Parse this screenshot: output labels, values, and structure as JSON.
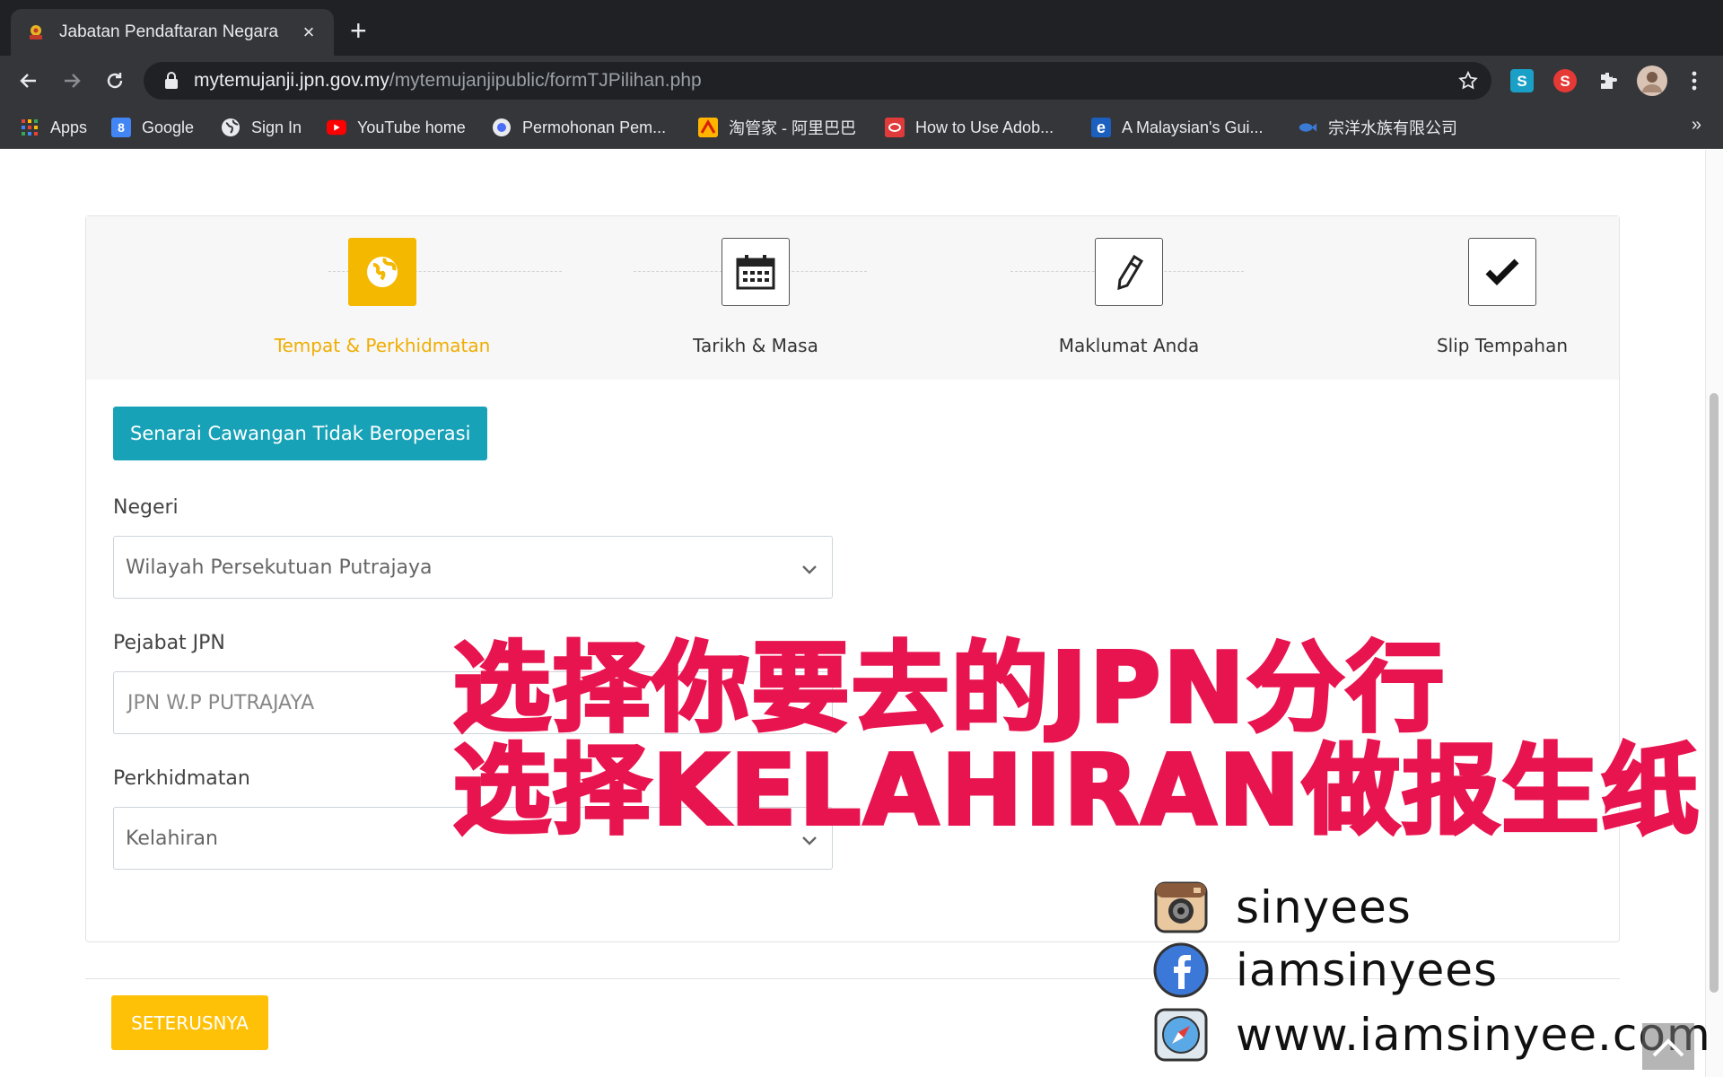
{
  "browser": {
    "tab_title": "Jabatan Pendaftaran Negara",
    "url_host": "mytemujanji.jpn.gov.my",
    "url_path": "/mytemujanjipublic/formTJPilihan.php",
    "bookmarks": [
      {
        "label": "Apps",
        "icon": "apps-grid-icon",
        "color": "#ea4335"
      },
      {
        "label": "Google",
        "icon": "google-sites-icon",
        "color": "#4285f4"
      },
      {
        "label": "Sign In",
        "icon": "globe-icon",
        "color": "#e8eaed"
      },
      {
        "label": "YouTube home",
        "icon": "youtube-icon",
        "color": "#ff0000"
      },
      {
        "label": "Permohonan Pem...",
        "icon": "circle-icon",
        "color": "#4a6cf7"
      },
      {
        "label": "淘管家 - 阿里巴巴",
        "icon": "taoguanjia-icon",
        "color": "#ffb400"
      },
      {
        "label": "How to Use Adob...",
        "icon": "adobe-icon",
        "color": "#e03a3a"
      },
      {
        "label": "A Malaysian's Gui...",
        "icon": "e-icon",
        "color": "#1b5fbf"
      },
      {
        "label": "宗洋水族有限公司",
        "icon": "fish-icon",
        "color": "#3a7bd5"
      }
    ],
    "more_bookmarks": "»"
  },
  "stepper": {
    "steps": [
      {
        "label": "Tempat & Perkhidmatan",
        "icon": "globe-icon",
        "active": true
      },
      {
        "label": "Tarikh & Masa",
        "icon": "calendar-icon",
        "active": false
      },
      {
        "label": "Maklumat Anda",
        "icon": "pencil-icon",
        "active": false
      },
      {
        "label": "Slip Tempahan",
        "icon": "checkmark-icon",
        "active": false
      }
    ],
    "active_color": "#f5b800"
  },
  "form": {
    "branch_button": "Senarai Cawangan Tidak Beroperasi",
    "negeri_label": "Negeri",
    "negeri_value": "Wilayah Persekutuan Putrajaya",
    "pejabat_label": "Pejabat JPN",
    "pejabat_value": "JPN W.P PUTRAJAYA",
    "perkhidmatan_label": "Perkhidmatan",
    "perkhidmatan_value": "Kelahiran",
    "next_button": "SETERUSNYA"
  },
  "overlay": {
    "line1": "选择你要去的JPN分行",
    "line2": "选择KELAHIRAN做报生纸",
    "color": "#e8144f",
    "social": [
      {
        "icon": "instagram-icon",
        "text": "sinyees"
      },
      {
        "icon": "facebook-icon",
        "text": "iamsinyees"
      },
      {
        "icon": "safari-compass-icon",
        "text": "www.iamsinyee.com"
      }
    ]
  },
  "colors": {
    "teal_button": "#17a2b8",
    "yellow_button": "#ffc107"
  }
}
